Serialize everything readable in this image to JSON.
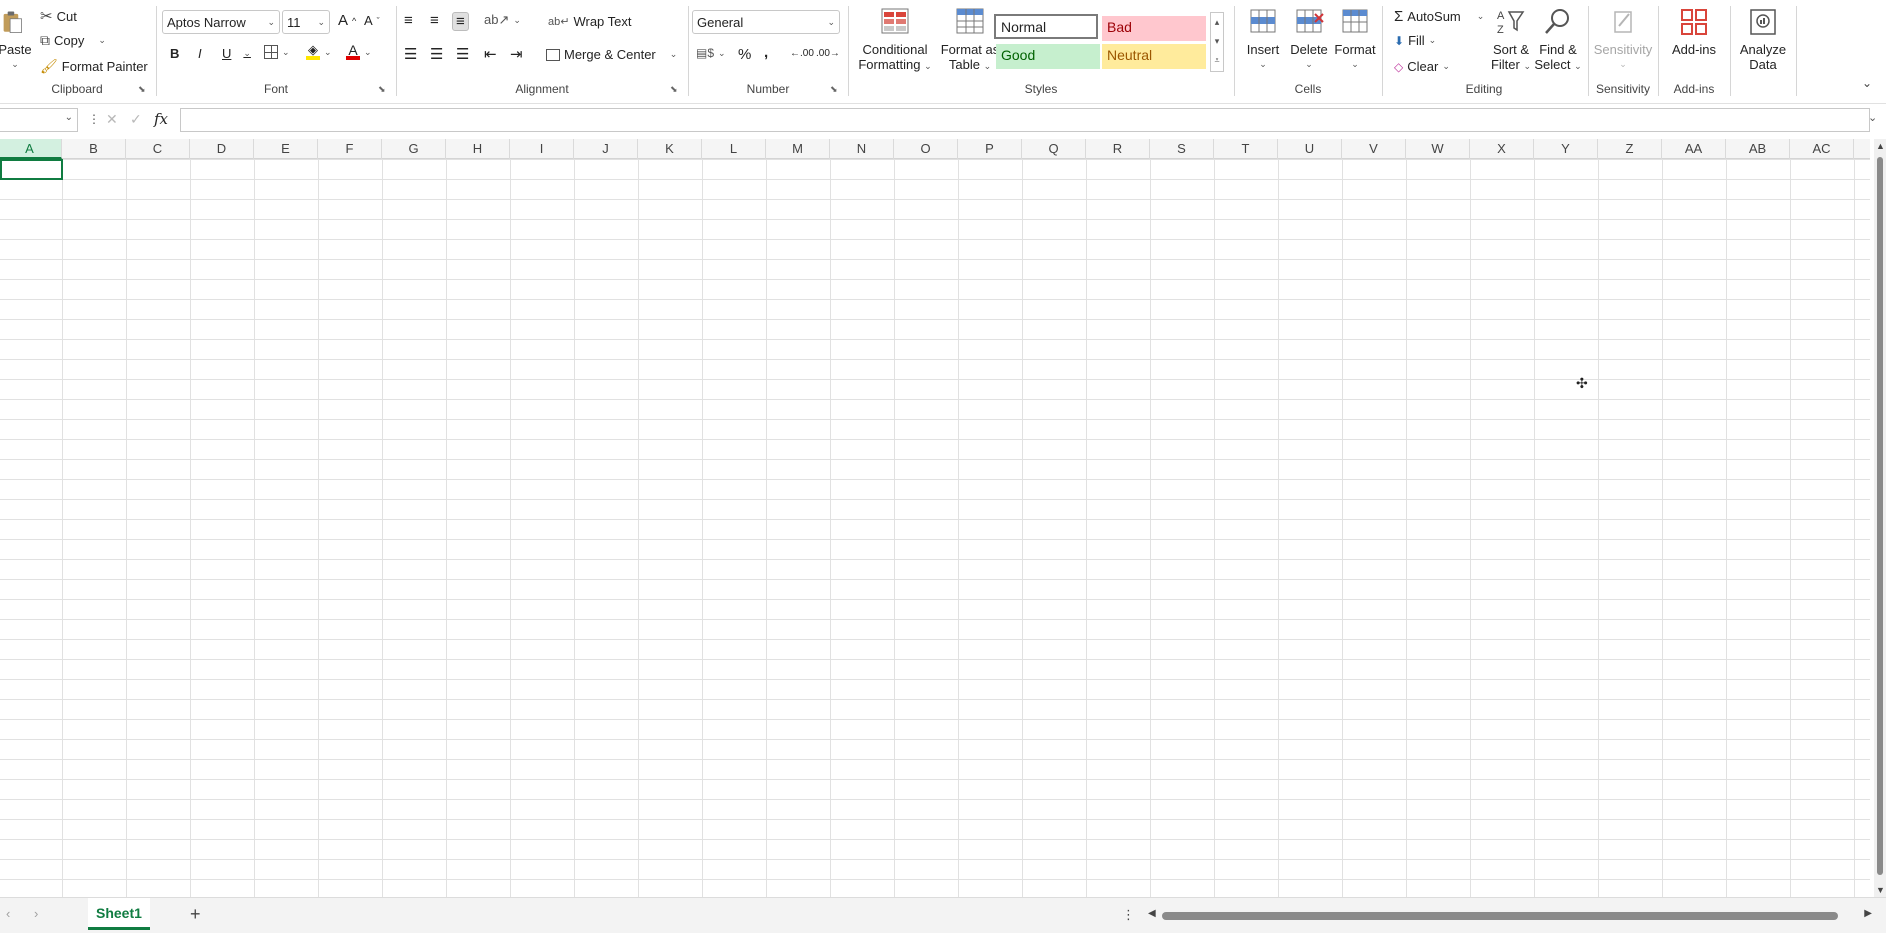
{
  "ribbon": {
    "clipboard": {
      "label": "Clipboard",
      "paste": "Paste",
      "cut": "Cut",
      "copy": "Copy",
      "format_painter": "Format Painter"
    },
    "font": {
      "label": "Font",
      "font_name": "Aptos Narrow",
      "font_size": "11",
      "grow": "A",
      "shrink": "A",
      "bold": "B",
      "italic": "I",
      "underline": "U"
    },
    "alignment": {
      "label": "Alignment",
      "wrap_text": "Wrap Text",
      "merge_center": "Merge & Center"
    },
    "number": {
      "label": "Number",
      "format": "General"
    },
    "styles": {
      "label": "Styles",
      "conditional_formatting_l1": "Conditional",
      "conditional_formatting_l2": "Formatting",
      "format_as_table_l1": "Format as",
      "format_as_table_l2": "Table",
      "normal": "Normal",
      "bad": "Bad",
      "good": "Good",
      "neutral": "Neutral"
    },
    "cells": {
      "label": "Cells",
      "insert": "Insert",
      "delete": "Delete",
      "format": "Format"
    },
    "editing": {
      "label": "Editing",
      "autosum": "AutoSum",
      "fill": "Fill",
      "clear": "Clear",
      "sort_filter_l1": "Sort &",
      "sort_filter_l2": "Filter",
      "find_select_l1": "Find &",
      "find_select_l2": "Select"
    },
    "sensitivity": {
      "label": "Sensitivity",
      "button": "Sensitivity"
    },
    "addins": {
      "label": "Add-ins",
      "button": "Add-ins"
    },
    "analyze": {
      "l1": "Analyze",
      "l2": "Data"
    }
  },
  "formula_bar": {
    "fx": "fx",
    "value": ""
  },
  "columns": [
    "A",
    "B",
    "C",
    "D",
    "E",
    "F",
    "G",
    "H",
    "I",
    "J",
    "K",
    "L",
    "M",
    "N",
    "O",
    "P",
    "Q",
    "R",
    "S",
    "T",
    "U",
    "V",
    "W",
    "X",
    "Y",
    "Z",
    "AA",
    "AB",
    "AC"
  ],
  "active_column": "A",
  "sheets": [
    {
      "name": "Sheet1",
      "active": true
    }
  ],
  "colors": {
    "accent": "#107c41",
    "bad_bg": "#ffc7ce",
    "bad_fg": "#9c0006",
    "good_bg": "#c6efce",
    "good_fg": "#006100",
    "neutral_bg": "#ffeb9c",
    "neutral_fg": "#9c5700"
  }
}
